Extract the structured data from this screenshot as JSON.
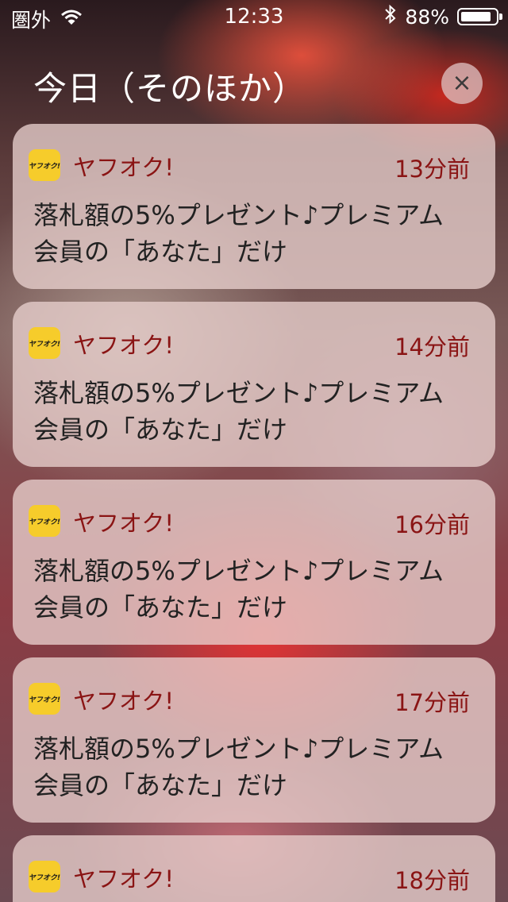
{
  "status_bar": {
    "carrier": "圏外",
    "time": "12:33",
    "battery_text": "88%",
    "battery_level": 0.88,
    "icons": [
      "wifi-icon",
      "bluetooth-icon",
      "battery-icon"
    ]
  },
  "header": {
    "title": "今日（そのほか）",
    "close_glyph": "×"
  },
  "notifications": [
    {
      "app_name": "ヤフオク!",
      "app_icon_text": "ヤフオク!",
      "time": "13分前",
      "message": "落札額の5%プレゼント♪プレミアム会員の「あなた」だけ"
    },
    {
      "app_name": "ヤフオク!",
      "app_icon_text": "ヤフオク!",
      "time": "14分前",
      "message": "落札額の5%プレゼント♪プレミアム会員の「あなた」だけ"
    },
    {
      "app_name": "ヤフオク!",
      "app_icon_text": "ヤフオク!",
      "time": "16分前",
      "message": "落札額の5%プレゼント♪プレミアム会員の「あなた」だけ"
    },
    {
      "app_name": "ヤフオク!",
      "app_icon_text": "ヤフオク!",
      "time": "17分前",
      "message": "落札額の5%プレゼント♪プレミアム会員の「あなた」だけ"
    },
    {
      "app_name": "ヤフオク!",
      "app_icon_text": "ヤフオク!",
      "time": "18分前",
      "message": ""
    }
  ],
  "colors": {
    "app_icon_bg": "#f6cc2b",
    "app_label": "#8a1414"
  }
}
